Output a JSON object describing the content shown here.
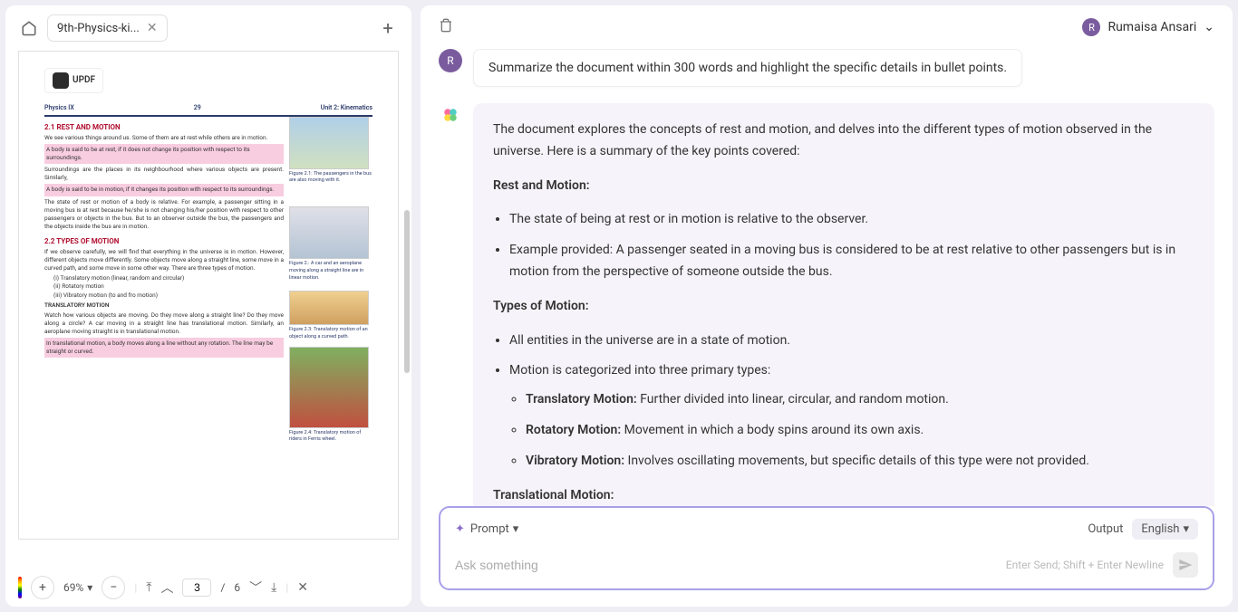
{
  "tab": {
    "name": "9th-Physics-ki...",
    "home_icon": "home"
  },
  "logo": {
    "text": "UPDF"
  },
  "page": {
    "subject": "Physics IX",
    "number": "29",
    "unit": "Unit 2: Kinematics",
    "sec21": "2.1  REST AND MOTION",
    "sec21_p1": "We see various things around us. Some of them are at rest while others are in motion.",
    "hl1": "A body is said to be at rest, if it does not change its position with respect to its surroundings.",
    "sec21_p2": "Surroundings are the places in its neighbourhood where various objects are present. Similarly,",
    "hl2": "A body is said to be in motion, if it changes its position with respect to its surroundings.",
    "sec21_p3": "The state of rest or motion of a body is relative. For example, a passenger sitting in a moving bus is at rest because he/she is not changing his/her position with respect to other passengers or objects in the bus. But to an observer outside the bus, the passengers and the objects inside the bus are in motion.",
    "sec22": "2.2  TYPES OF MOTION",
    "sec22_p1": "If we observe carefully, we will find that everything in the universe is in motion. However, different objects move differently. Some objects move along a straight line, some move in a curved path, and some move in some other way. There are three types of motion.",
    "li1": "(i)   Translatory motion (linear, random and circular)",
    "li2": "(ii)  Rotatory motion",
    "li3": "(iii) Vibratory motion  (to and fro motion)",
    "trans_title": "TRANSLATORY MOTION",
    "trans_p": "Watch how various objects are moving. Do they move along a straight line? Do they move along a circle? A car moving in a straight line has translational motion. Similarly, an aeroplane moving straight is in translational motion.",
    "hl3": "In translational motion, a body moves along a line without any rotation. The line may be straight or curved.",
    "fig21": "Figure 2.1: The passengers in the bus are also moving with it.",
    "fig22": "Figure 2.: A car and an aeroplane moving along a straight line are in linear motion.",
    "fig23": "Figure 2.3: Translatory motion of an object along a curved path.",
    "fig24": "Figure 2.4: Translatory motion of riders in Ferris wheel."
  },
  "toolbar": {
    "zoom": "69%",
    "page_current": "3",
    "page_total": "6"
  },
  "chat": {
    "user_name": "Rumaisa Ansari",
    "user_initial": "R",
    "user_msg": "Summarize the document within 300 words and highlight the specific details in bullet points.",
    "ai_intro": "The document explores the concepts of rest and motion, and delves into the different types of motion observed in the universe. Here is a summary of the key points covered:",
    "h1": "Rest and Motion:",
    "b1": "The state of being at rest or in motion is relative to the observer.",
    "b2": "Example provided: A passenger seated in a moving bus is considered to be at rest relative to other passengers but is in motion from the perspective of someone outside the bus.",
    "h2": "Types of Motion:",
    "b3": "All entities in the universe are in a state of motion.",
    "b4": "Motion is categorized into three primary types:",
    "b4a_label": "Translatory Motion:",
    "b4a_text": " Further divided into linear, circular, and random motion.",
    "b4b_label": "Rotatory Motion:",
    "b4b_text": " Movement in which a body spins around its own axis.",
    "b4c_label": "Vibratory Motion:",
    "b4c_text": " Involves oscillating movements, but specific details of this type were not provided.",
    "h3": "Translational Motion:"
  },
  "input": {
    "prompt_label": "Prompt",
    "output_label": "Output",
    "lang": "English",
    "placeholder": "Ask something",
    "hint": "Enter Send; Shift + Enter Newline"
  }
}
